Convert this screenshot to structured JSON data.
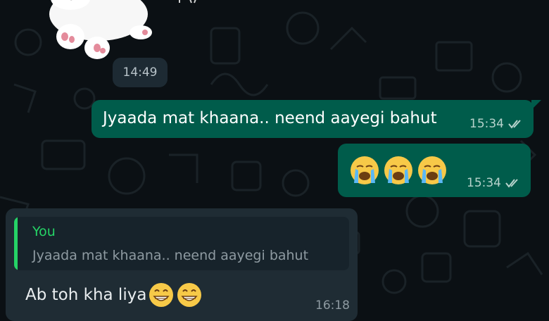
{
  "chat": {
    "date_chip": "14:49",
    "messages": [
      {
        "text": "Jyaada mat khaana.. neend aayegi bahut",
        "time": "15:34",
        "status": "read-double-check-icon"
      },
      {
        "emojis": [
          "loudly-crying-face-icon",
          "loudly-crying-face-icon",
          "loudly-crying-face-icon"
        ],
        "time": "15:34",
        "status": "read-double-check-icon"
      }
    ],
    "incoming": {
      "quote_author": "You",
      "quote_text": "Jyaada mat khaana.. neend aayegi bahut",
      "text": "Ab toh kha liya",
      "emojis": [
        "grinning-face-icon",
        "grinning-face-icon"
      ],
      "time": "16:18"
    }
  },
  "colors": {
    "background": "#0b1014",
    "outgoing_bubble": "#005c4b",
    "incoming_bubble": "#1f2c34",
    "quote_accent": "#25d366"
  }
}
